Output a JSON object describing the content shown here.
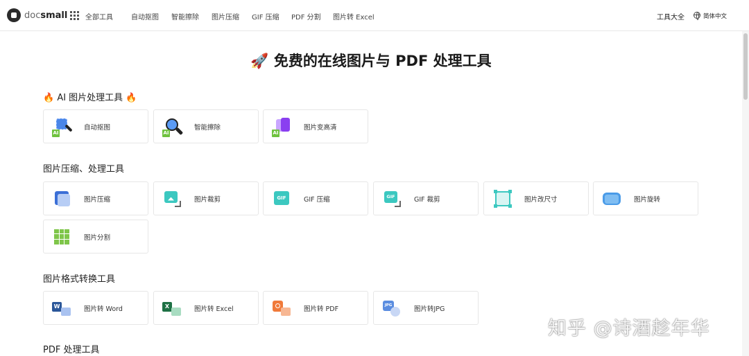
{
  "header": {
    "logo_doc": "doc",
    "logo_small": "small",
    "all_tools": "全部工具",
    "nav": [
      "自动抠图",
      "智能擦除",
      "图片压缩",
      "GIF 压缩",
      "PDF 分割",
      "图片转 Excel"
    ],
    "tools_list": "工具大全",
    "language": "简体中文"
  },
  "title": {
    "emoji": "🚀",
    "text": "免费的在线图片与 PDF 处理工具"
  },
  "sections": {
    "ai": {
      "title": "🔥 AI 图片处理工具 🔥",
      "items": [
        "自动抠图",
        "智能擦除",
        "图片变高清"
      ]
    },
    "compress": {
      "title": "图片压缩、处理工具",
      "items": [
        "图片压缩",
        "图片裁剪",
        "GIF 压缩",
        "GIF 裁剪",
        "图片改尺寸",
        "图片旋转",
        "图片分割"
      ]
    },
    "convert": {
      "title": "图片格式转换工具",
      "items": [
        "图片转 Word",
        "图片转 Excel",
        "图片转 PDF",
        "图片转JPG"
      ]
    },
    "pdf": {
      "title": "PDF 处理工具"
    }
  },
  "icons": {
    "ai_badge": "AI",
    "gif": "GIF",
    "word": "W",
    "excel": "X",
    "jpg": "JPG"
  },
  "colors": {
    "ai_green": "#6fc23f",
    "blue": "#3b6fd6",
    "teal": "#3cc8c0",
    "purple": "#8a3ff0",
    "word_blue": "#2a5699",
    "excel_green": "#1e7145",
    "pdf_orange": "#f07a3a"
  },
  "watermark": "知乎 @诗酒趁年华"
}
